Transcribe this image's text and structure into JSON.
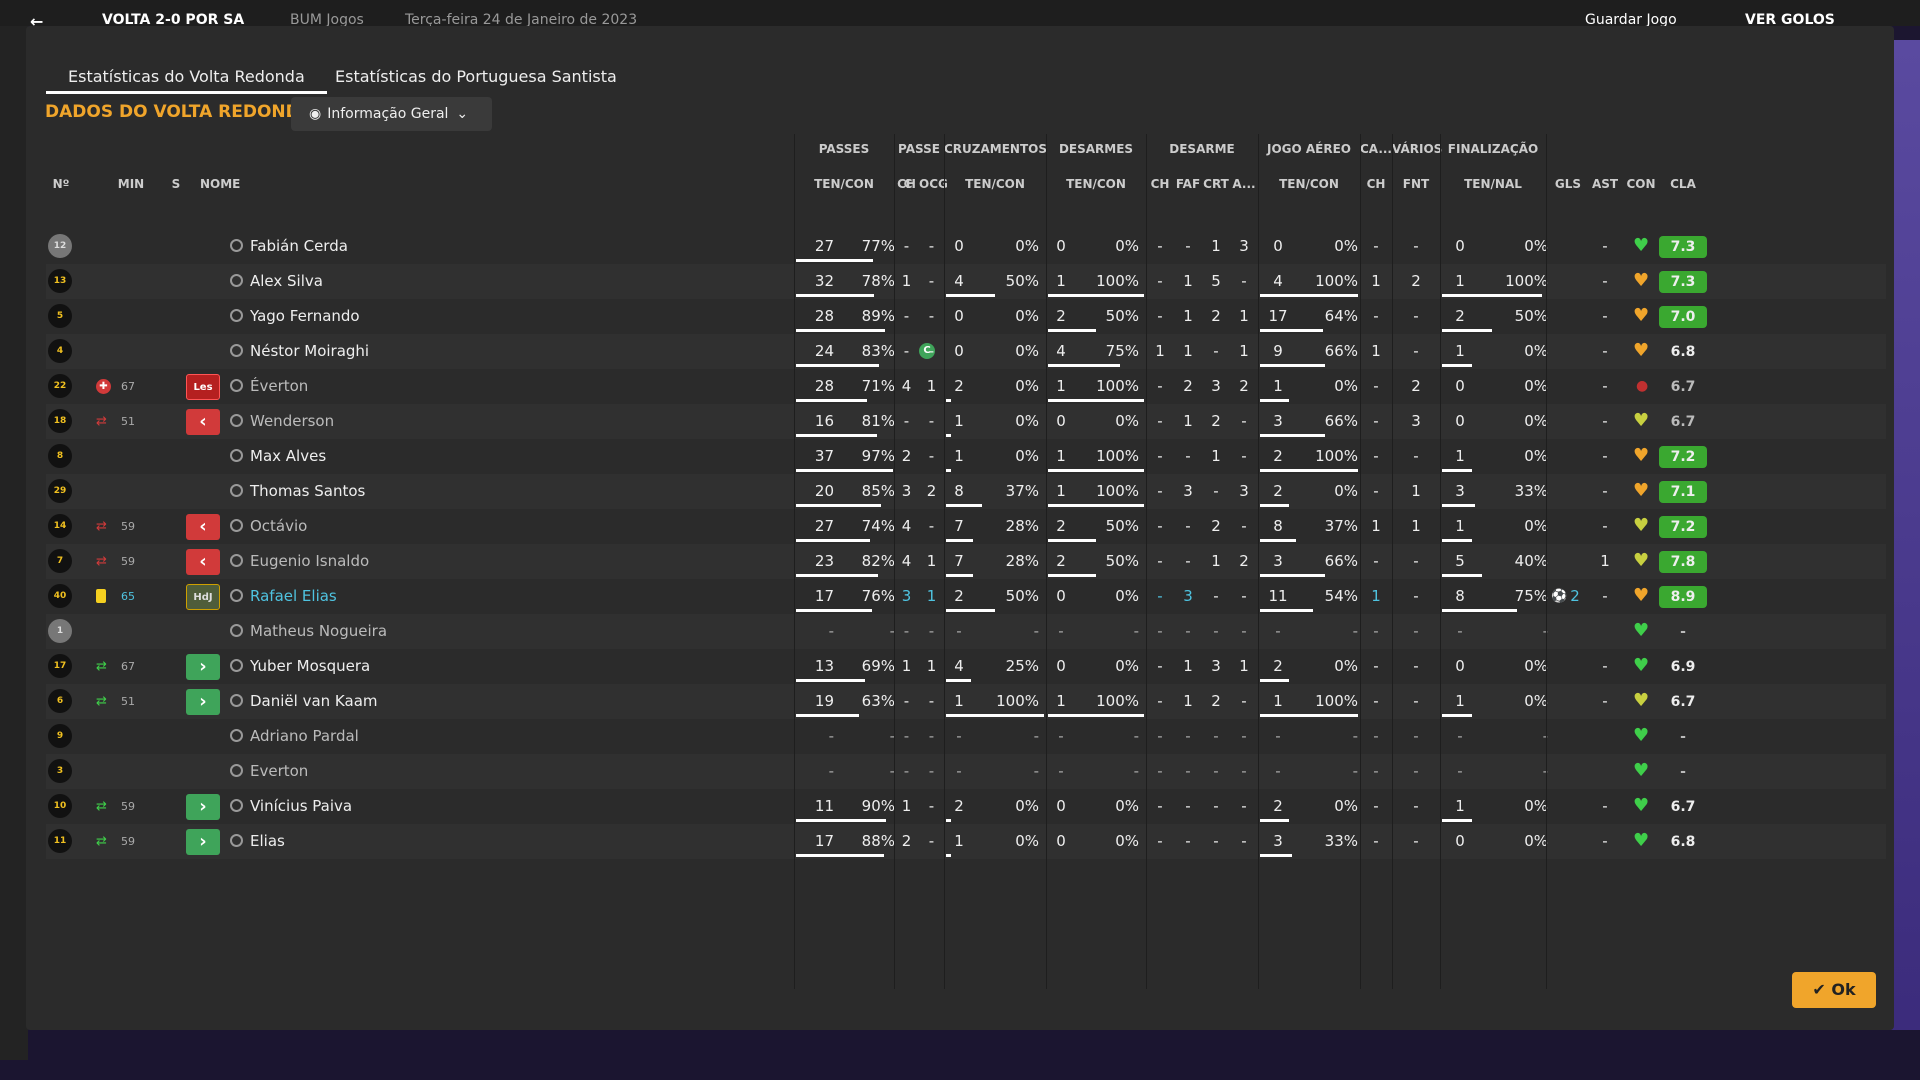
{
  "topbar": {
    "match": "VOLTA 2-0 POR SA",
    "competition": "BUM Jogos",
    "date": "Terça-feira 24 de Janeiro de 2023",
    "save": "Guardar Jogo",
    "view": "VER GOLOS"
  },
  "tabs": [
    "Estatísticas do Volta Redonda",
    "Estatísticas do Portuguesa Santista"
  ],
  "title": "DADOS DO VOLTA REDONDA",
  "dropdown": "Informação Geral",
  "ok": "Ok",
  "group_headers": [
    "PASSES",
    "PASSE",
    "CRUZAMENTOS",
    "DESARMES",
    "DESARME",
    "JOGO AÉREO",
    "CA...",
    "VÁRIOS",
    "FINALIZAÇÃO"
  ],
  "col_headers": {
    "num": "Nº",
    "min": "MIN",
    "s": "S",
    "name": "NOME",
    "c": "C",
    "passes": "TEN/CON",
    "passe_ch": "CH",
    "passe_ocg": "OCG",
    "cruz": "TEN/CON",
    "des": "TEN/CON",
    "desarme_ch": "CH",
    "desarme_faf": "FAF",
    "desarme_crt": "CRT",
    "desarme_a": "A...",
    "aereo": "TEN/CON",
    "ca_ch": "CH",
    "varios_fnt": "FNT",
    "fin": "TEN/NAL",
    "gls": "GLS",
    "ast": "AST",
    "con": "CON",
    "cla": "CLA"
  },
  "colors": {
    "accent": "#f0a52b",
    "rating_green": "#3aa830",
    "red": "#d13a3a",
    "green": "#3fa45a"
  },
  "rows": [
    {
      "num": "12",
      "gk": true,
      "min": "",
      "ev": "",
      "sub": "",
      "name": "Fabián Cerda",
      "c": "",
      "p1": "27",
      "p2": "77%",
      "pch": "-",
      "pocg": "-",
      "cr1": "0",
      "cr2": "0%",
      "d1": "0",
      "d2": "0%",
      "dch": "-",
      "dfaf": "-",
      "dcrt": "1",
      "da": "3",
      "a1": "0",
      "a2": "0%",
      "cach": "-",
      "fnt": "-",
      "f1": "0",
      "f2": "0%",
      "gls": "",
      "ast": "-",
      "heart": "g",
      "cla": "7.3",
      "hl": true,
      "pf": 0.77,
      "crf": 0,
      "df": 0,
      "af": 0,
      "ff": 0
    },
    {
      "num": "13",
      "min": "",
      "ev": "",
      "sub": "",
      "name": "Alex Silva",
      "c": "",
      "p1": "32",
      "p2": "78%",
      "pch": "1",
      "pocg": "-",
      "cr1": "4",
      "cr2": "50%",
      "d1": "1",
      "d2": "100%",
      "dch": "-",
      "dfaf": "1",
      "dcrt": "5",
      "da": "-",
      "a1": "4",
      "a2": "100%",
      "cach": "1",
      "fnt": "2",
      "f1": "1",
      "f2": "100%",
      "gls": "",
      "ast": "-",
      "heart": "o",
      "cla": "7.3",
      "hl": true,
      "pf": 0.78,
      "crf": 0.5,
      "df": 1,
      "af": 1,
      "ff": 1
    },
    {
      "num": "5",
      "min": "",
      "ev": "",
      "sub": "",
      "name": "Yago Fernando",
      "c": "",
      "p1": "28",
      "p2": "89%",
      "pch": "-",
      "pocg": "-",
      "cr1": "0",
      "cr2": "0%",
      "d1": "2",
      "d2": "50%",
      "dch": "-",
      "dfaf": "1",
      "dcrt": "2",
      "da": "1",
      "a1": "17",
      "a2": "64%",
      "cach": "-",
      "fnt": "-",
      "f1": "2",
      "f2": "50%",
      "gls": "",
      "ast": "-",
      "heart": "o",
      "cla": "7.0",
      "hl": true,
      "pf": 0.89,
      "crf": 0,
      "df": 0.5,
      "af": 0.64,
      "ff": 0.5
    },
    {
      "num": "4",
      "min": "",
      "ev": "",
      "sub": "",
      "name": "Néstor Moiraghi",
      "c": "C",
      "p1": "24",
      "p2": "83%",
      "pch": "-",
      "pocg": "-",
      "cr1": "0",
      "cr2": "0%",
      "d1": "4",
      "d2": "75%",
      "dch": "1",
      "dfaf": "1",
      "dcrt": "-",
      "da": "1",
      "a1": "9",
      "a2": "66%",
      "cach": "1",
      "fnt": "-",
      "f1": "1",
      "f2": "0%",
      "gls": "",
      "ast": "-",
      "heart": "o",
      "cla": "6.8",
      "hl": false,
      "pf": 0.83,
      "crf": 0,
      "df": 0.75,
      "af": 0.66,
      "ff": 0
    },
    {
      "num": "22",
      "min": "67",
      "ev": "inj",
      "sub": "les",
      "name": "Éverton",
      "dim": true,
      "c": "",
      "p1": "28",
      "p2": "71%",
      "pch": "4",
      "pocg": "1",
      "cr1": "2",
      "cr2": "0%",
      "d1": "1",
      "d2": "100%",
      "dch": "-",
      "dfaf": "2",
      "dcrt": "3",
      "da": "2",
      "a1": "1",
      "a2": "0%",
      "cach": "-",
      "fnt": "2",
      "f1": "0",
      "f2": "0%",
      "gls": "",
      "ast": "-",
      "heart": "r",
      "cla": "6.7",
      "hl": false,
      "pf": 0.71,
      "crf": 0,
      "df": 1,
      "af": 0,
      "ff": 0
    },
    {
      "num": "18",
      "min": "51",
      "ev": "out",
      "sub": "out",
      "name": "Wenderson",
      "dim": true,
      "c": "",
      "p1": "16",
      "p2": "81%",
      "pch": "-",
      "pocg": "-",
      "cr1": "1",
      "cr2": "0%",
      "d1": "0",
      "d2": "0%",
      "dch": "-",
      "dfaf": "1",
      "dcrt": "2",
      "da": "-",
      "a1": "3",
      "a2": "66%",
      "cach": "-",
      "fnt": "3",
      "f1": "0",
      "f2": "0%",
      "gls": "",
      "ast": "-",
      "heart": "y",
      "cla": "6.7",
      "hl": false,
      "pf": 0.81,
      "crf": 0,
      "df": 0,
      "af": 0.66,
      "ff": 0
    },
    {
      "num": "8",
      "min": "",
      "ev": "",
      "sub": "",
      "name": "Max Alves",
      "c": "",
      "p1": "37",
      "p2": "97%",
      "pch": "2",
      "pocg": "-",
      "cr1": "1",
      "cr2": "0%",
      "d1": "1",
      "d2": "100%",
      "dch": "-",
      "dfaf": "-",
      "dcrt": "1",
      "da": "-",
      "a1": "2",
      "a2": "100%",
      "cach": "-",
      "fnt": "-",
      "f1": "1",
      "f2": "0%",
      "gls": "",
      "ast": "-",
      "heart": "o",
      "cla": "7.2",
      "hl": true,
      "pf": 0.97,
      "crf": 0,
      "df": 1,
      "af": 1,
      "ff": 0
    },
    {
      "num": "29",
      "min": "",
      "ev": "",
      "sub": "",
      "name": "Thomas Santos",
      "c": "",
      "p1": "20",
      "p2": "85%",
      "pch": "3",
      "pocg": "2",
      "cr1": "8",
      "cr2": "37%",
      "d1": "1",
      "d2": "100%",
      "dch": "-",
      "dfaf": "3",
      "dcrt": "-",
      "da": "3",
      "a1": "2",
      "a2": "0%",
      "cach": "-",
      "fnt": "1",
      "f1": "3",
      "f2": "33%",
      "gls": "",
      "ast": "-",
      "heart": "o",
      "cla": "7.1",
      "hl": true,
      "pf": 0.85,
      "crf": 0.37,
      "df": 1,
      "af": 0,
      "ff": 0.33
    },
    {
      "num": "14",
      "min": "59",
      "ev": "out",
      "sub": "out",
      "name": "Octávio",
      "dim": true,
      "c": "",
      "p1": "27",
      "p2": "74%",
      "pch": "4",
      "pocg": "-",
      "cr1": "7",
      "cr2": "28%",
      "d1": "2",
      "d2": "50%",
      "dch": "-",
      "dfaf": "-",
      "dcrt": "2",
      "da": "-",
      "a1": "8",
      "a2": "37%",
      "cach": "1",
      "fnt": "1",
      "f1": "1",
      "f2": "0%",
      "gls": "",
      "ast": "-",
      "heart": "y",
      "cla": "7.2",
      "hl": true,
      "pf": 0.74,
      "crf": 0.28,
      "df": 0.5,
      "af": 0.37,
      "ff": 0
    },
    {
      "num": "7",
      "min": "59",
      "ev": "out",
      "sub": "out",
      "name": "Eugenio Isnaldo",
      "dim": true,
      "c": "",
      "p1": "23",
      "p2": "82%",
      "pch": "4",
      "pocg": "1",
      "cr1": "7",
      "cr2": "28%",
      "d1": "2",
      "d2": "50%",
      "dch": "-",
      "dfaf": "-",
      "dcrt": "1",
      "da": "2",
      "a1": "3",
      "a2": "66%",
      "cach": "-",
      "fnt": "-",
      "f1": "5",
      "f2": "40%",
      "gls": "",
      "ast": "1",
      "heart": "y",
      "cla": "7.8",
      "hl": true,
      "pf": 0.82,
      "crf": 0.28,
      "df": 0.5,
      "af": 0.66,
      "ff": 0.4
    },
    {
      "num": "40",
      "min": "65",
      "ev": "yellow",
      "sub": "hdj",
      "name": "Rafael Elias",
      "blue": true,
      "c": "",
      "p1": "17",
      "p2": "76%",
      "pch": "3",
      "pocg": "1",
      "cr1": "2",
      "cr2": "50%",
      "d1": "0",
      "d2": "0%",
      "dch": "-",
      "dfaf": "3",
      "dcrt": "-",
      "da": "-",
      "a1": "11",
      "a2": "54%",
      "cach": "1",
      "fnt": "-",
      "f1": "8",
      "f2": "75%",
      "gls": "2",
      "ast": "-",
      "heart": "o",
      "cla": "8.9",
      "hl": true,
      "pf": 0.76,
      "crf": 0.5,
      "df": 0,
      "af": 0.54,
      "ff": 0.75
    },
    {
      "num": "1",
      "gk": true,
      "min": "",
      "ev": "",
      "sub": "",
      "name": "Matheus Nogueira",
      "dim": true,
      "c": "",
      "p1": "-",
      "p2": "-",
      "pch": "-",
      "pocg": "-",
      "cr1": "-",
      "cr2": "-",
      "d1": "-",
      "d2": "-",
      "dch": "-",
      "dfaf": "-",
      "dcrt": "-",
      "da": "-",
      "a1": "-",
      "a2": "-",
      "cach": "-",
      "fnt": "-",
      "f1": "-",
      "f2": "-",
      "gls": "",
      "ast": "",
      "heart": "g",
      "cla": "-",
      "hl": false,
      "pf": 0,
      "crf": 0,
      "df": 0,
      "af": 0,
      "ff": 0
    },
    {
      "num": "17",
      "min": "67",
      "ev": "in",
      "sub": "in",
      "name": "Yuber Mosquera",
      "c": "",
      "p1": "13",
      "p2": "69%",
      "pch": "1",
      "pocg": "1",
      "cr1": "4",
      "cr2": "25%",
      "d1": "0",
      "d2": "0%",
      "dch": "-",
      "dfaf": "1",
      "dcrt": "3",
      "da": "1",
      "a1": "2",
      "a2": "0%",
      "cach": "-",
      "fnt": "-",
      "f1": "0",
      "f2": "0%",
      "gls": "",
      "ast": "-",
      "heart": "g",
      "cla": "6.9",
      "hl": false,
      "pf": 0.69,
      "crf": 0.25,
      "df": 0,
      "af": 0,
      "ff": 0
    },
    {
      "num": "6",
      "min": "51",
      "ev": "in",
      "sub": "in",
      "name": "Daniël van Kaam",
      "c": "",
      "p1": "19",
      "p2": "63%",
      "pch": "-",
      "pocg": "-",
      "cr1": "1",
      "cr2": "100%",
      "d1": "1",
      "d2": "100%",
      "dch": "-",
      "dfaf": "1",
      "dcrt": "2",
      "da": "-",
      "a1": "1",
      "a2": "100%",
      "cach": "-",
      "fnt": "-",
      "f1": "1",
      "f2": "0%",
      "gls": "",
      "ast": "-",
      "heart": "y",
      "cla": "6.7",
      "hl": false,
      "pf": 0.63,
      "crf": 1,
      "df": 1,
      "af": 1,
      "ff": 0
    },
    {
      "num": "9",
      "min": "",
      "ev": "",
      "sub": "",
      "name": "Adriano Pardal",
      "dim": true,
      "c": "",
      "p1": "-",
      "p2": "-",
      "pch": "-",
      "pocg": "-",
      "cr1": "-",
      "cr2": "-",
      "d1": "-",
      "d2": "-",
      "dch": "-",
      "dfaf": "-",
      "dcrt": "-",
      "da": "-",
      "a1": "-",
      "a2": "-",
      "cach": "-",
      "fnt": "-",
      "f1": "-",
      "f2": "-",
      "gls": "",
      "ast": "",
      "heart": "g",
      "cla": "-",
      "hl": false,
      "pf": 0,
      "crf": 0,
      "df": 0,
      "af": 0,
      "ff": 0
    },
    {
      "num": "3",
      "min": "",
      "ev": "",
      "sub": "",
      "name": "Everton",
      "dim": true,
      "c": "",
      "p1": "-",
      "p2": "-",
      "pch": "-",
      "pocg": "-",
      "cr1": "-",
      "cr2": "-",
      "d1": "-",
      "d2": "-",
      "dch": "-",
      "dfaf": "-",
      "dcrt": "-",
      "da": "-",
      "a1": "-",
      "a2": "-",
      "cach": "-",
      "fnt": "-",
      "f1": "-",
      "f2": "-",
      "gls": "",
      "ast": "",
      "heart": "g",
      "cla": "-",
      "hl": false,
      "pf": 0,
      "crf": 0,
      "df": 0,
      "af": 0,
      "ff": 0
    },
    {
      "num": "10",
      "min": "59",
      "ev": "in",
      "sub": "in",
      "name": "Vinícius Paiva",
      "c": "",
      "p1": "11",
      "p2": "90%",
      "pch": "1",
      "pocg": "-",
      "cr1": "2",
      "cr2": "0%",
      "d1": "0",
      "d2": "0%",
      "dch": "-",
      "dfaf": "-",
      "dcrt": "-",
      "da": "-",
      "a1": "2",
      "a2": "0%",
      "cach": "-",
      "fnt": "-",
      "f1": "1",
      "f2": "0%",
      "gls": "",
      "ast": "-",
      "heart": "g",
      "cla": "6.7",
      "hl": false,
      "pf": 0.9,
      "crf": 0,
      "df": 0,
      "af": 0,
      "ff": 0
    },
    {
      "num": "11",
      "min": "59",
      "ev": "in",
      "sub": "in",
      "name": "Elias",
      "c": "",
      "p1": "17",
      "p2": "88%",
      "pch": "2",
      "pocg": "-",
      "cr1": "1",
      "cr2": "0%",
      "d1": "0",
      "d2": "0%",
      "dch": "-",
      "dfaf": "-",
      "dcrt": "-",
      "da": "-",
      "a1": "3",
      "a2": "33%",
      "cach": "-",
      "fnt": "-",
      "f1": "0",
      "f2": "0%",
      "gls": "",
      "ast": "-",
      "heart": "g",
      "cla": "6.8",
      "hl": false,
      "pf": 0.88,
      "crf": 0,
      "df": 0,
      "af": 0.33,
      "ff": 0
    }
  ]
}
